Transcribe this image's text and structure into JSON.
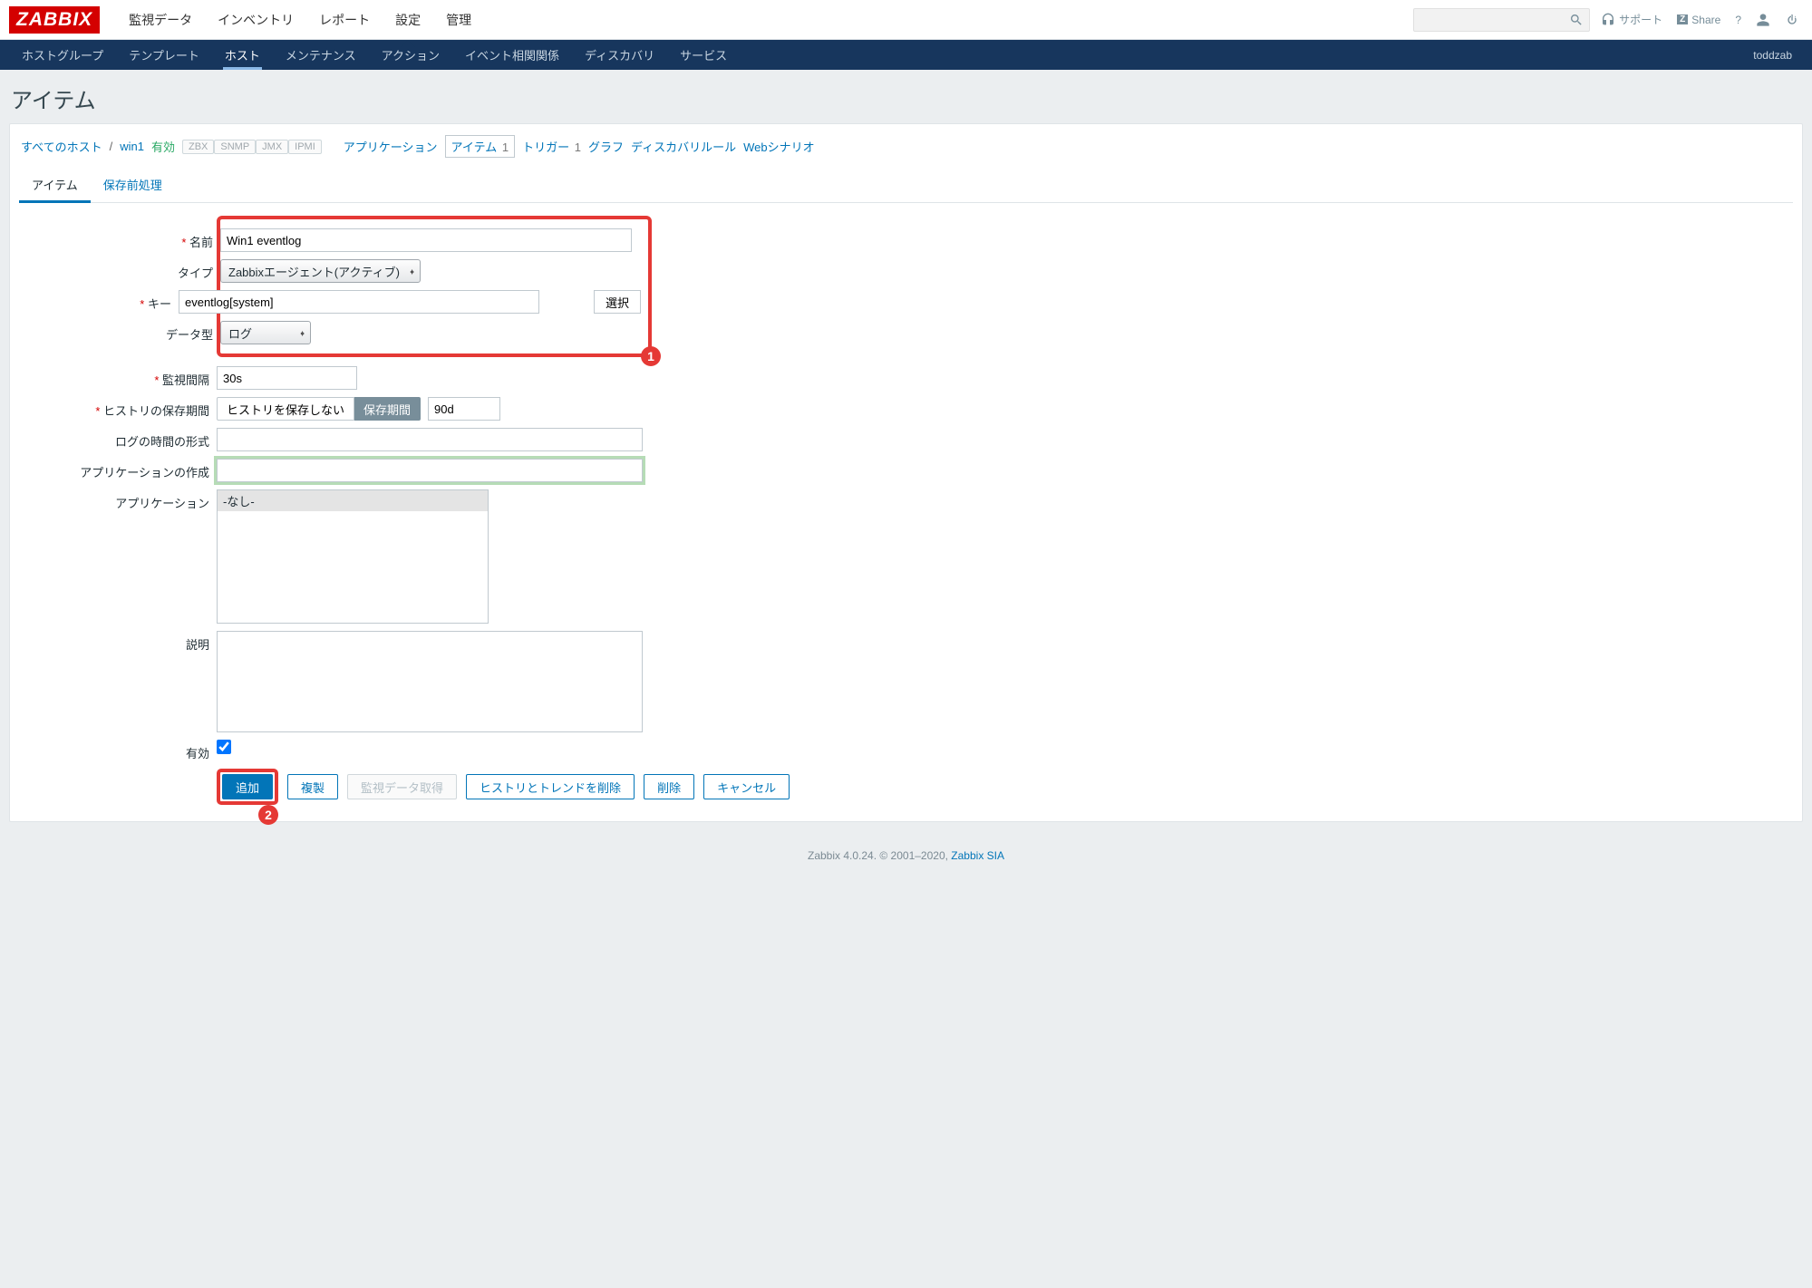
{
  "logo": "ZABBIX",
  "topnav": [
    "監視データ",
    "インベントリ",
    "レポート",
    "設定",
    "管理"
  ],
  "topnav_active": 3,
  "top_right": {
    "support": "サポート",
    "share": "Share",
    "help": "?"
  },
  "subnav": [
    "ホストグループ",
    "テンプレート",
    "ホスト",
    "メンテナンス",
    "アクション",
    "イベント相関関係",
    "ディスカバリ",
    "サービス"
  ],
  "subnav_active": 2,
  "username": "toddzab",
  "page_title": "アイテム",
  "breadcrumb": {
    "all_hosts": "すべてのホスト",
    "host": "win1",
    "status": "有効",
    "chips": [
      "ZBX",
      "SNMP",
      "JMX",
      "IPMI"
    ],
    "links": [
      {
        "label": "アプリケーション",
        "count": ""
      },
      {
        "label": "アイテム",
        "count": "1",
        "active": true
      },
      {
        "label": "トリガー",
        "count": "1"
      },
      {
        "label": "グラフ",
        "count": ""
      },
      {
        "label": "ディスカバリルール",
        "count": ""
      },
      {
        "label": "Webシナリオ",
        "count": ""
      }
    ]
  },
  "tabs": [
    "アイテム",
    "保存前処理"
  ],
  "tabs_active": 0,
  "form": {
    "name_label": "名前",
    "name_value": "Win1 eventlog",
    "type_label": "タイプ",
    "type_value": "Zabbixエージェント(アクティブ)",
    "key_label": "キー",
    "key_value": "eventlog[system]",
    "key_select": "選択",
    "datatype_label": "データ型",
    "datatype_value": "ログ",
    "interval_label": "監視間隔",
    "interval_value": "30s",
    "history_label": "ヒストリの保存期間",
    "history_seg": [
      "ヒストリを保存しない",
      "保存期間"
    ],
    "history_seg_active": 1,
    "history_value": "90d",
    "logtime_label": "ログの時間の形式",
    "logtime_value": "",
    "newapp_label": "アプリケーションの作成",
    "newapp_value": "",
    "app_label": "アプリケーション",
    "app_option": "-なし-",
    "desc_label": "説明",
    "enabled_label": "有効",
    "enabled_checked": true
  },
  "buttons": {
    "add": "追加",
    "clone": "複製",
    "execute": "監視データ取得",
    "clear": "ヒストリとトレンドを削除",
    "delete": "削除",
    "cancel": "キャンセル"
  },
  "footer": {
    "text": "Zabbix 4.0.24. © 2001–2020, ",
    "link": "Zabbix SIA"
  }
}
